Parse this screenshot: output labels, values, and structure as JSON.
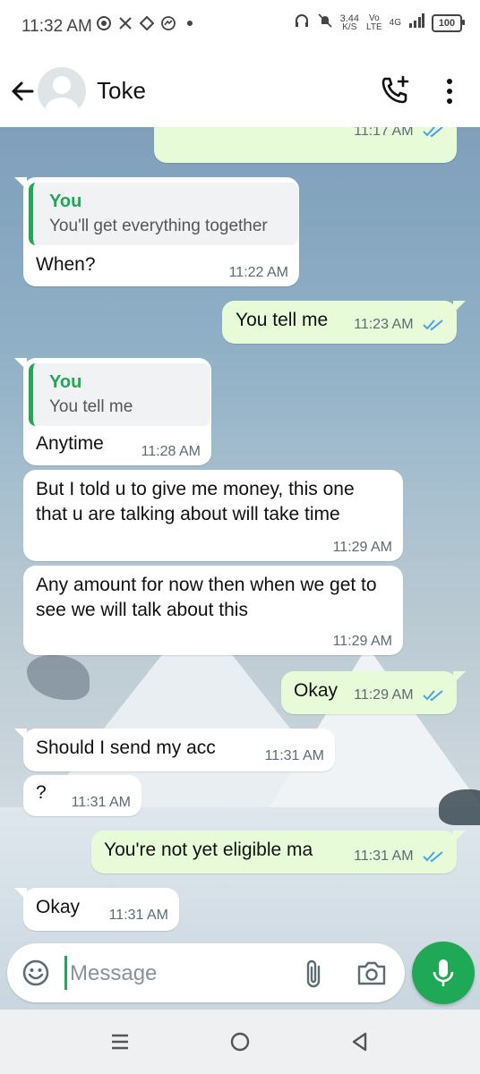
{
  "status_bar": {
    "time": "11:32 AM",
    "left_icons": [
      "chrome-icon",
      "x-icon",
      "app-icon",
      "messenger-icon",
      "dot-icon"
    ],
    "net_speed": "3.44",
    "net_unit": "K/S",
    "vo": "Vo",
    "lte": "LTE",
    "network": "4G",
    "battery": "100"
  },
  "header": {
    "contact_name": "Toke"
  },
  "messages": [
    {
      "dir": "out",
      "text": "",
      "time": "11:17 AM",
      "read": true
    },
    {
      "dir": "in",
      "quote_name": "You",
      "quote_text": "You'll get everything together",
      "text": "When?",
      "time": "11:22 AM"
    },
    {
      "dir": "out",
      "text": "You tell me",
      "time": "11:23 AM",
      "read": true
    },
    {
      "dir": "in",
      "quote_name": "You",
      "quote_text": "You tell me",
      "text": "Anytime",
      "time": "11:28 AM"
    },
    {
      "dir": "in",
      "text": "But I told u to give me money, this one that u are talking about will take time",
      "time": "11:29 AM"
    },
    {
      "dir": "in",
      "text": "Any amount for now then when we get to see we will talk about this",
      "time": "11:29 AM"
    },
    {
      "dir": "out",
      "text": "Okay",
      "time": "11:29 AM",
      "read": true
    },
    {
      "dir": "in",
      "text": "Should I send my acc",
      "time": "11:31 AM"
    },
    {
      "dir": "in",
      "text": "?",
      "time": "11:31 AM"
    },
    {
      "dir": "out",
      "text": "You're not yet eligible ma",
      "time": "11:31 AM",
      "read": true
    },
    {
      "dir": "in",
      "text": "Okay",
      "time": "11:31 AM"
    }
  ],
  "composer": {
    "placeholder": "Message"
  },
  "colors": {
    "accent": "#1fa855",
    "outgoing_bubble": "#e7fbd9",
    "incoming_bubble": "#ffffff",
    "read_ticks": "#4aa3e8"
  }
}
